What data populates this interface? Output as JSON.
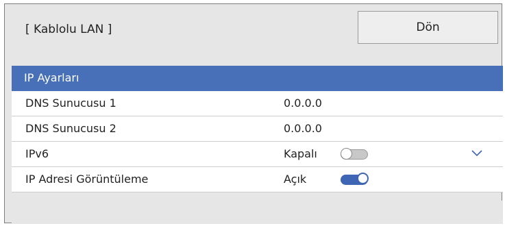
{
  "header": {
    "title": "[ Kablolu LAN ]",
    "back_label": "Dön"
  },
  "rows": [
    {
      "label": "IP Ayarları",
      "value": "",
      "selected": true
    },
    {
      "label": "DNS Sunucusu 1",
      "value": "0.0.0.0"
    },
    {
      "label": "DNS Sunucusu 2",
      "value": "0.0.0.0"
    },
    {
      "label": "IPv6",
      "value": "Kapalı",
      "toggle": "off",
      "icon": "chevron-down-icon"
    },
    {
      "label": "IP Adresi Görüntüleme",
      "value": "Açık",
      "toggle": "on"
    }
  ],
  "colors": {
    "selection": "#4870b8",
    "toggle_on": "#3e66b5",
    "toggle_off": "#c8c8c8"
  }
}
